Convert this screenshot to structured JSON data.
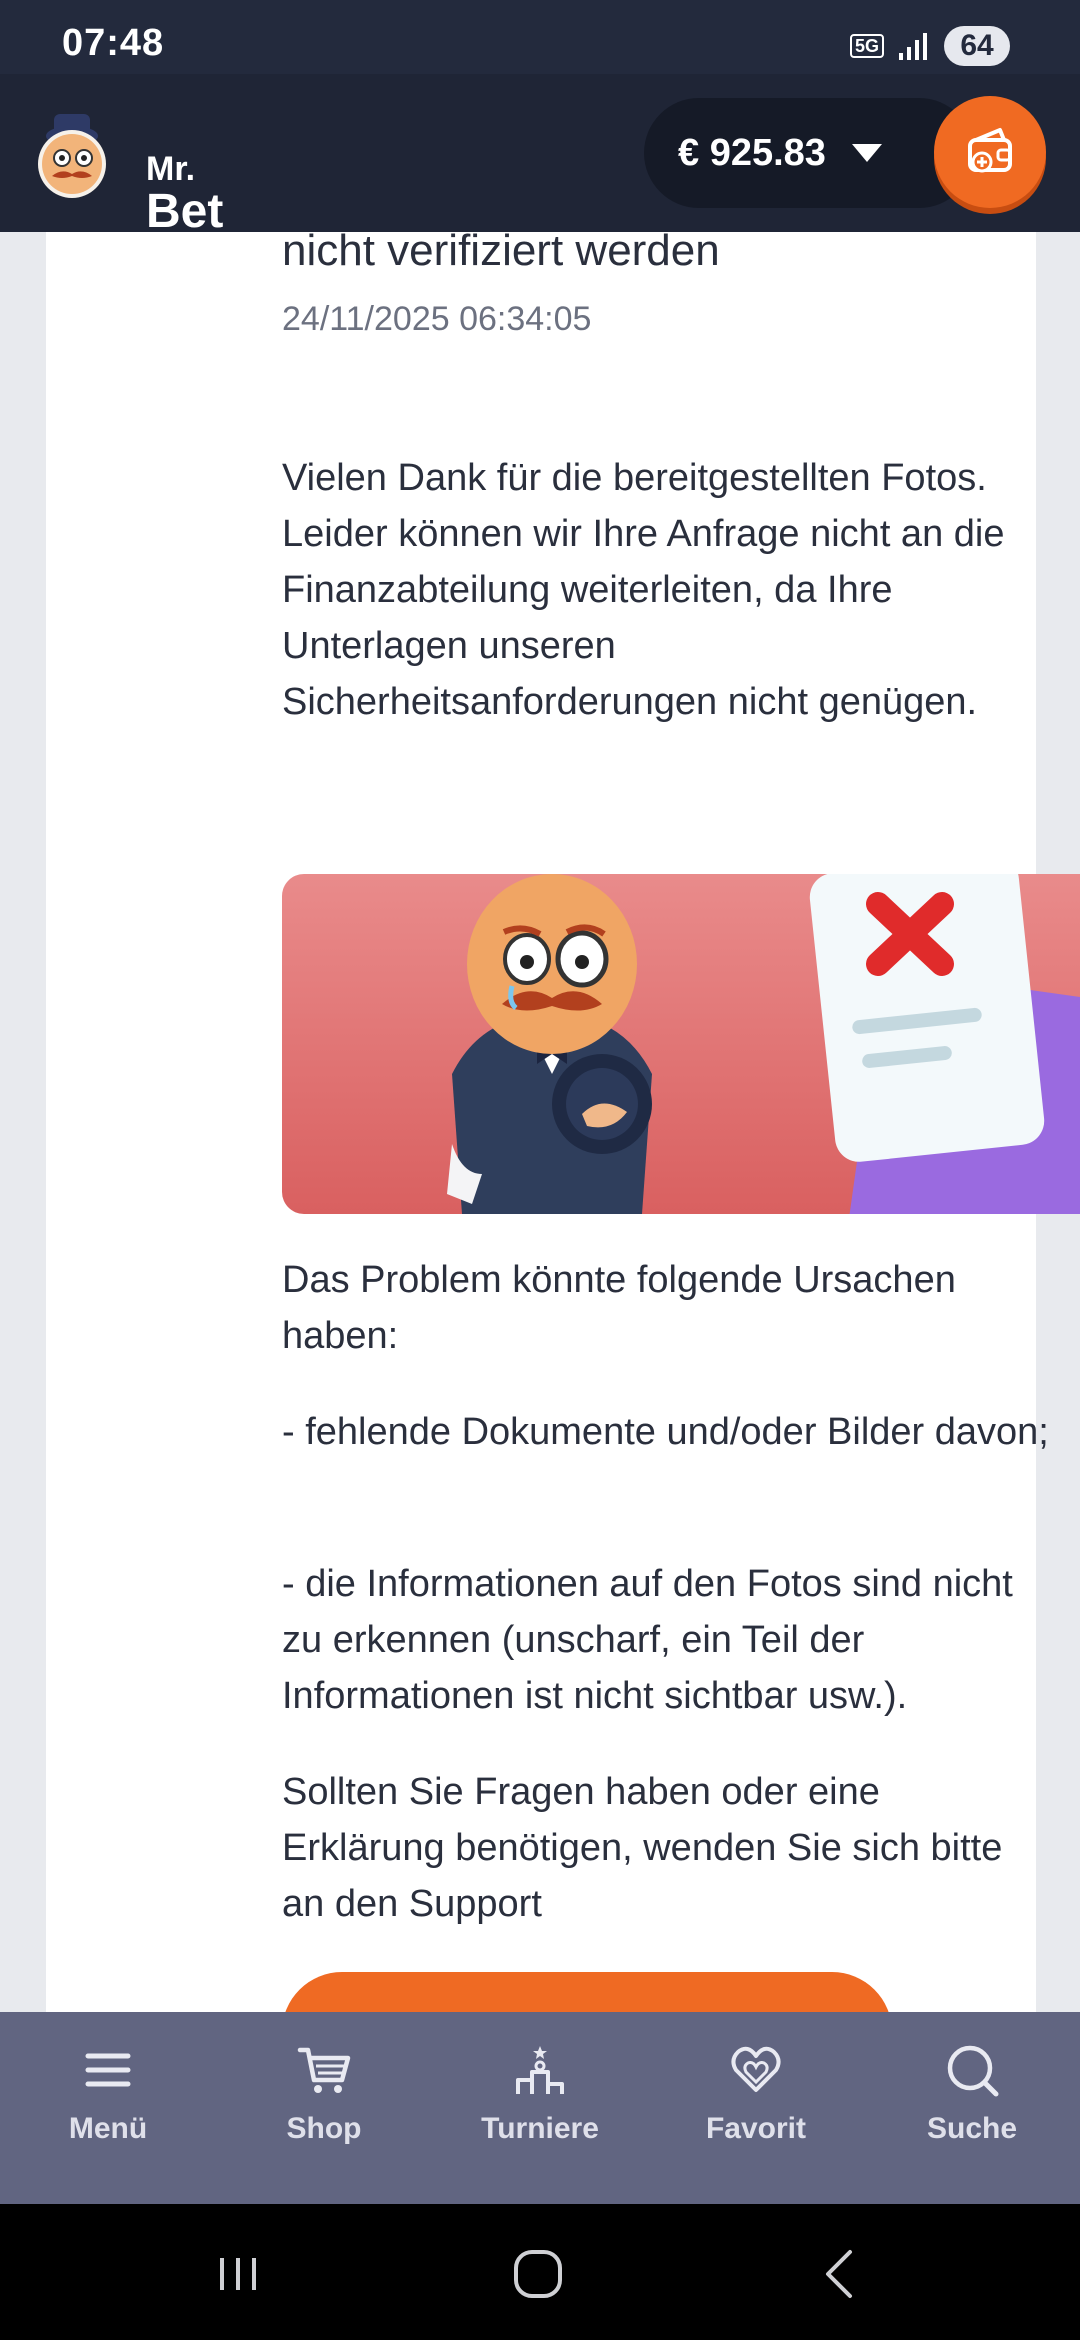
{
  "status_bar": {
    "time": "07:48",
    "network": "5G",
    "battery": "64"
  },
  "header": {
    "logo_line1": "Mr.",
    "logo_line2": "Bet",
    "balance": "€ 925.83",
    "balance_dropdown_icon": "caret-down-icon",
    "deposit_icon": "wallet-plus-icon",
    "accent": "#f06a22"
  },
  "message": {
    "title_fragment": "nicht verifiziert werden",
    "date": "24/11/2025 06:34:05",
    "paragraph_1": "Vielen Dank für die bereitgestellten Fotos. Leider können wir Ihre Anfrage nicht an die Finanzabteilung weiterleiten, da Ihre Unterlagen unseren Sicherheitsanforderungen nicht genügen.",
    "paragraph_2": "Das Problem könnte folgende Ursachen haben:",
    "paragraph_3": "- fehlende Dokumente und/oder Bilder davon;",
    "paragraph_4": "- die Informationen auf den Fotos sind nicht zu erkennen (unscharf, ein Teil der Informationen ist nicht sichtbar usw.).",
    "paragraph_5": "Sollten Sie Fragen haben oder eine Erklärung benötigen, wenden Sie sich bitte an den Support"
  },
  "bottom_nav": [
    {
      "label": "Menü",
      "icon": "menu-icon"
    },
    {
      "label": "Shop",
      "icon": "cart-icon"
    },
    {
      "label": "Turniere",
      "icon": "tournament-icon"
    },
    {
      "label": "Favorit",
      "icon": "heart-icon"
    },
    {
      "label": "Suche",
      "icon": "search-icon"
    }
  ]
}
